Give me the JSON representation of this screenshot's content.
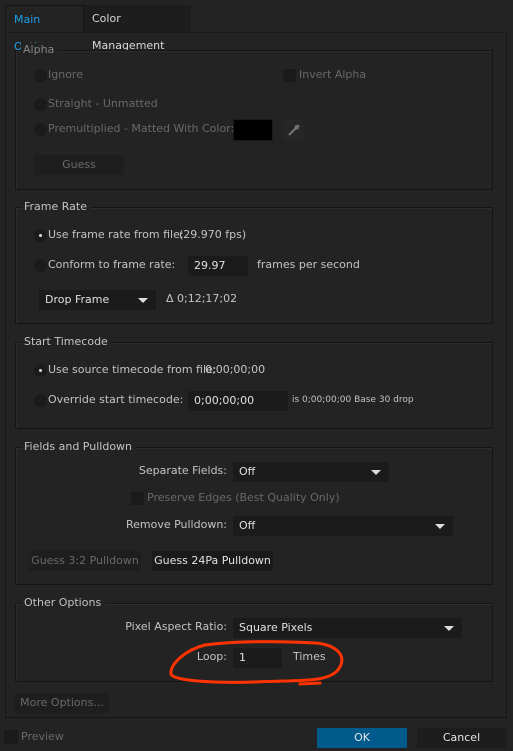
{
  "tabs": [
    {
      "label": "Main Options",
      "active": true
    },
    {
      "label": "Color Management"
    }
  ],
  "alpha": {
    "title": "Alpha",
    "ignore": "Ignore",
    "invert": "Invert Alpha",
    "straight": "Straight - Unmatted",
    "premult": "Premultiplied - Matted With Color:",
    "matte_color": "#000000",
    "guess": "Guess"
  },
  "frame_rate": {
    "title": "Frame Rate",
    "use_file": "Use frame rate from file:",
    "file_fps": "(29.970 fps)",
    "conform": "Conform to frame rate:",
    "conform_value": "29.97",
    "fps_unit": "frames per second",
    "drop_frame": "Drop Frame",
    "delta": "Δ 0;12;17;02"
  },
  "start_timecode": {
    "title": "Start Timecode",
    "use_source": "Use source timecode from file:",
    "source_value": "0;00;00;00",
    "override": "Override start timecode:",
    "override_value": "0;00;00;00",
    "info": "is 0;00;00;00  Base 30  drop"
  },
  "fields": {
    "title": "Fields and Pulldown",
    "separate_label": "Separate Fields:",
    "separate_value": "Off",
    "preserve": "Preserve Edges (Best Quality Only)",
    "remove_label": "Remove Pulldown:",
    "remove_value": "Off",
    "guess32": "Guess 3:2 Pulldown",
    "guess24": "Guess 24Pa Pulldown"
  },
  "other": {
    "title": "Other Options",
    "par_label": "Pixel Aspect Ratio:",
    "par_value": "Square Pixels",
    "loop_label": "Loop:",
    "loop_value": "1",
    "loop_unit": "Times",
    "annotation_color": "#ff3300"
  },
  "more_options": "More Options...",
  "footer": {
    "preview": "Preview",
    "ok": "OK",
    "cancel": "Cancel",
    "ok_color": "#005a8c"
  }
}
